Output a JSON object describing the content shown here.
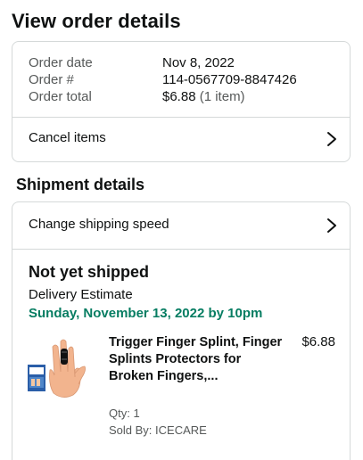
{
  "page": {
    "title": "View order details"
  },
  "order_summary": {
    "rows": [
      {
        "label": "Order date",
        "value": "Nov 8, 2022"
      },
      {
        "label": "Order #",
        "value": "114-0567709-8847426"
      },
      {
        "label": "Order total",
        "value": "$6.88",
        "count": "(1 item)"
      }
    ],
    "cancel_label": "Cancel items"
  },
  "shipment": {
    "section_title": "Shipment details",
    "change_speed_label": "Change shipping speed",
    "status": "Not yet shipped",
    "estimate_label": "Delivery Estimate",
    "estimate_date": "Sunday, November 13, 2022 by 10pm",
    "item": {
      "name": "Trigger Finger Splint, Finger Splints Protectors for Broken Fingers,...",
      "price": "$6.88",
      "qty": "Qty: 1",
      "sold_by": "Sold By: ICECARE",
      "image_icon": "finger-splint-product-image"
    }
  },
  "colors": {
    "delivery_green": "#067d62",
    "muted_text": "#565959",
    "border": "#d5d9d9"
  }
}
